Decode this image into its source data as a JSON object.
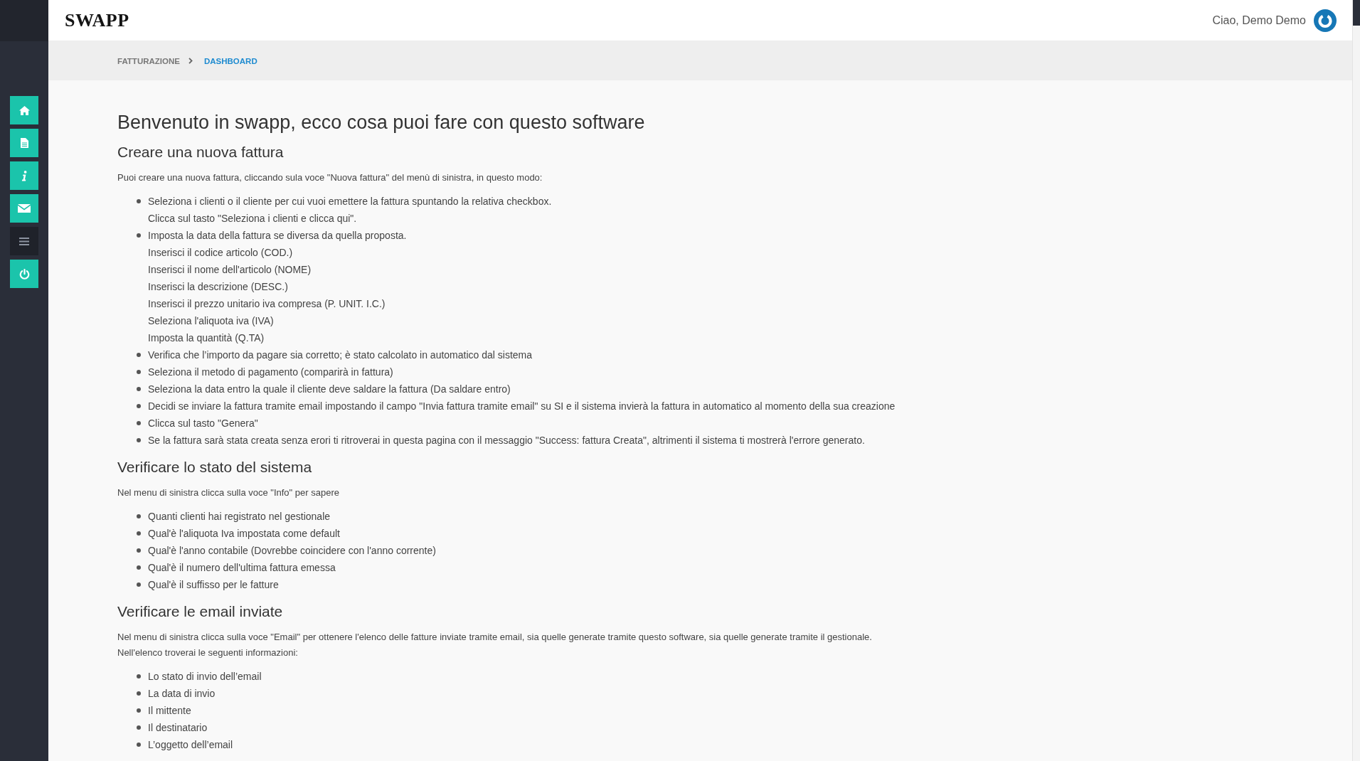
{
  "sidebar": {
    "buttons": [
      {
        "kind": "home"
      },
      {
        "kind": "document"
      },
      {
        "kind": "info"
      },
      {
        "kind": "mail"
      },
      {
        "kind": "menu"
      },
      {
        "kind": "power"
      }
    ]
  },
  "header": {
    "logo": "SWAPP",
    "greeting": "Ciao, Demo Demo"
  },
  "breadcrumb": [
    {
      "label": "FATTURAZIONE",
      "selected": false
    },
    {
      "label": "DASHBOARD",
      "selected": true
    }
  ],
  "content": {
    "title": "Benvenuto in swapp, ecco cosa puoi fare con questo software",
    "sections": [
      {
        "heading": "Creare una nuova fattura",
        "paragraphs": [
          "Puoi creare una nuova fattura, cliccando sula voce \"Nuova fattura\" del menù di sinistra, in questo modo:"
        ],
        "items": [
          {
            "lines": [
              "Seleziona i clienti o il cliente per cui vuoi emettere la fattura spuntando la relativa checkbox.",
              "Clicca sul tasto \"Seleziona i clienti e clicca qui\"."
            ]
          },
          {
            "lines": [
              "Imposta la data della fattura se diversa da quella proposta.",
              "Inserisci il codice articolo (COD.)",
              "Inserisci il nome dell'articolo (NOME)",
              "Inserisci la descrizione (DESC.)",
              "Inserisci il prezzo unitario iva compresa (P. UNIT. I.C.)",
              "Seleziona l'aliquota iva (IVA)",
              "Imposta la quantità (Q.TA)"
            ]
          },
          {
            "lines": [
              "Verifica che l’importo da pagare sia corretto; è stato calcolato in automatico dal sistema"
            ]
          },
          {
            "lines": [
              "Seleziona il metodo di pagamento (comparirà in fattura)"
            ]
          },
          {
            "lines": [
              "Seleziona la data entro la quale il cliente deve saldare la fattura (Da saldare entro)"
            ]
          },
          {
            "lines": [
              "Decidi se inviare la fattura tramite email impostando il campo \"Invia fattura tramite email\" su SI e il sistema invierà la fattura in automatico al momento della sua creazione"
            ]
          },
          {
            "lines": [
              "Clicca sul tasto \"Genera\""
            ]
          },
          {
            "lines": [
              "Se la fattura sarà stata creata senza erori ti ritroverai in questa pagina con il messaggio \"Success: fattura Creata\", altrimenti il sistema ti mostrerà l'errore generato."
            ]
          }
        ]
      },
      {
        "heading": "Verificare lo stato del sistema",
        "paragraphs": [
          "Nel menu di sinistra clicca sulla voce \"Info\" per sapere"
        ],
        "items": [
          {
            "lines": [
              "Quanti clienti hai registrato nel gestionale"
            ]
          },
          {
            "lines": [
              "Qual'è l'aliquota Iva impostata come default"
            ]
          },
          {
            "lines": [
              "Qual'è l'anno contabile (Dovrebbe coincidere con l'anno corrente)"
            ]
          },
          {
            "lines": [
              "Qual'è il numero dell'ultima fattura emessa"
            ]
          },
          {
            "lines": [
              "Qual'è il suffisso per le fatture"
            ]
          }
        ]
      },
      {
        "heading": "Verificare le email inviate",
        "paragraphs": [
          "Nel menu di sinistra clicca sulla voce \"Email\" per ottenere l'elenco delle fatture inviate tramite email, sia quelle generate tramite questo software, sia quelle generate tramite il gestionale.",
          "Nell'elenco troverai le seguenti informazioni:"
        ],
        "items": [
          {
            "lines": [
              "Lo stato di invio dell’email"
            ]
          },
          {
            "lines": [
              "La data di invio"
            ]
          },
          {
            "lines": [
              "Il mittente"
            ]
          },
          {
            "lines": [
              "Il destinatario"
            ]
          },
          {
            "lines": [
              "L’oggetto dell’email"
            ]
          }
        ]
      }
    ]
  }
}
